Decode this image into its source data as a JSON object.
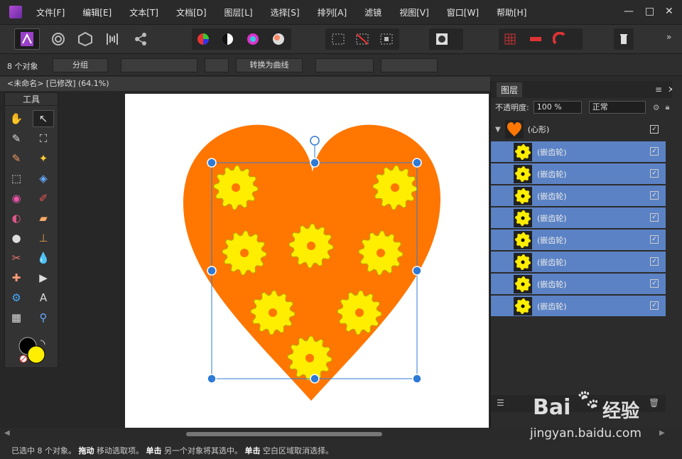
{
  "menubar": {
    "items": [
      "文件[F]",
      "编辑[E]",
      "文本[T]",
      "文档[D]",
      "图层[L]",
      "选择[S]",
      "排列[A]",
      "滤镜",
      "视图[V]",
      "窗口[W]",
      "帮助[H]"
    ],
    "window_controls": {
      "minimize": "—",
      "maximize": "□",
      "close": "✕"
    }
  },
  "context": {
    "selection_count": "8 个对象",
    "group_label": "分组",
    "convert_label": "转换为曲线"
  },
  "document": {
    "tab_title": "<未命名> [已修改] (64.1%)"
  },
  "tools_panel": {
    "title": "工具"
  },
  "layers_panel": {
    "title": "图层",
    "opacity_label": "不透明度:",
    "opacity_value": "100 %",
    "blend_mode": "正常",
    "group_name": "(心形)",
    "layers": [
      {
        "name": "(嵌齿轮)"
      },
      {
        "name": "(嵌齿轮)"
      },
      {
        "name": "(嵌齿轮)"
      },
      {
        "name": "(嵌齿轮)"
      },
      {
        "name": "(嵌齿轮)"
      },
      {
        "name": "(嵌齿轮)"
      },
      {
        "name": "(嵌齿轮)"
      },
      {
        "name": "(嵌齿轮)"
      }
    ]
  },
  "status": {
    "prefix": "已选中 8 个对象。",
    "drag": "拖动",
    "drag_desc": "移动选取项。",
    "click": "单击",
    "click_desc": "另一个对象将其选中。",
    "click2": "单击",
    "click2_desc": "空白区域取消选择。"
  },
  "watermark": {
    "brand": "Bai",
    "brand2": "经验",
    "url": "jingyan.baidu.com"
  },
  "colors": {
    "heart": "#ff7600",
    "gear": "#ffee00",
    "gear_stroke": "#b8a800",
    "selection": "#2f7ad6",
    "layer_selected": "#5b82c4"
  }
}
